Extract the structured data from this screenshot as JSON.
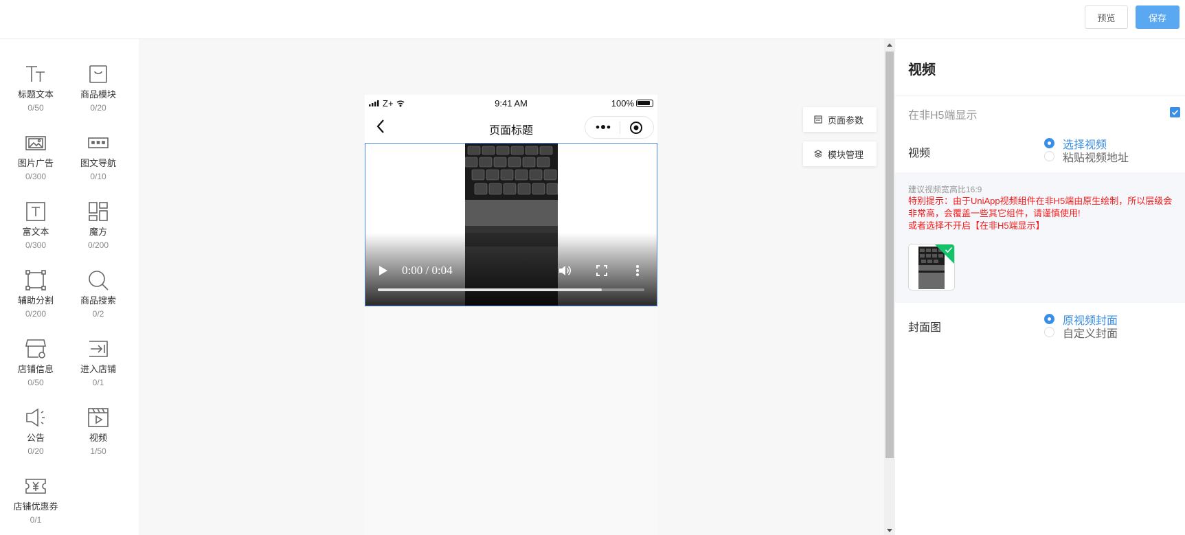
{
  "header": {
    "preview_label": "预览",
    "save_label": "保存"
  },
  "components": [
    {
      "name": "标题文本",
      "count": "0/50",
      "icon": "text-icon"
    },
    {
      "name": "商品模块",
      "count": "0/20",
      "icon": "shopping-bag-icon"
    },
    {
      "name": "图片广告",
      "count": "0/300",
      "icon": "image-icon"
    },
    {
      "name": "图文导航",
      "count": "0/10",
      "icon": "nav-icon"
    },
    {
      "name": "富文本",
      "count": "0/300",
      "icon": "rich-text-icon"
    },
    {
      "name": "魔方",
      "count": "0/200",
      "icon": "grid-icon"
    },
    {
      "name": "辅助分割",
      "count": "0/200",
      "icon": "divider-icon"
    },
    {
      "name": "商品搜索",
      "count": "0/2",
      "icon": "search-icon"
    },
    {
      "name": "店铺信息",
      "count": "0/50",
      "icon": "shop-icon"
    },
    {
      "name": "进入店铺",
      "count": "0/1",
      "icon": "enter-shop-icon"
    },
    {
      "name": "公告",
      "count": "0/20",
      "icon": "megaphone-icon"
    },
    {
      "name": "视频",
      "count": "1/50",
      "icon": "video-icon"
    },
    {
      "name": "店铺优惠券",
      "count": "0/1",
      "icon": "coupon-icon"
    }
  ],
  "phone": {
    "carrier": "Z+",
    "time": "9:41 AM",
    "battery": "100%",
    "page_title": "页面标题",
    "video": {
      "time_display": "0:00 / 0:04",
      "progress": 0.84
    }
  },
  "floating": {
    "page_params": "页面参数",
    "module_manage": "模块管理"
  },
  "settings": {
    "title": "视频",
    "non_h5_label": "在非H5端显示",
    "non_h5_checked": true,
    "video_label": "视频",
    "video_options": [
      "选择视频",
      "粘贴视频地址"
    ],
    "video_selected": 0,
    "tip_ratio": "建议视频宽高比16:9",
    "tip_warning": "特别提示：由于UniApp视频组件在非H5端由原生绘制，所以层级会非常高，会覆盖一些其它组件，请谨慎使用!",
    "tip_alt": "或者选择不开启【在非H5端显示】",
    "cover_label": "封面图",
    "cover_options": [
      "原视频封面",
      "自定义封面"
    ],
    "cover_selected": 0
  },
  "colors": {
    "accent": "#3a8ee6",
    "save_button": "#5aa8f2",
    "warning": "#f11d1d",
    "check_corner": "#13c26b"
  }
}
